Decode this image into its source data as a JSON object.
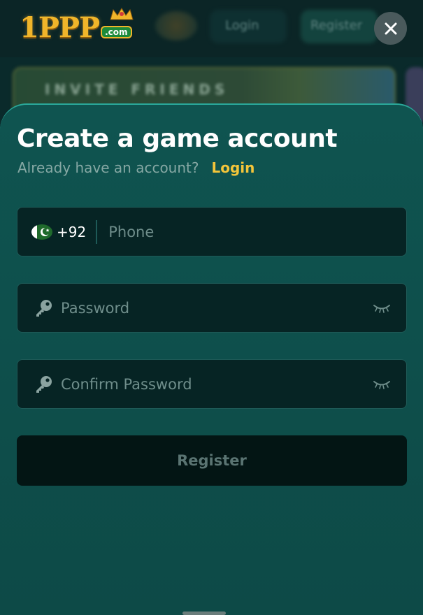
{
  "background": {
    "logo_text": "1PPP",
    "logo_suffix": ".com",
    "nav_login": "Login",
    "nav_register": "Register",
    "banner_text": "INVITE FRIENDS"
  },
  "modal": {
    "title": "Create a game account",
    "subtitle": "Already have an account?",
    "login_link": "Login",
    "phone": {
      "country_code": "+92",
      "placeholder": "Phone",
      "flag": "pakistan-flag-icon"
    },
    "password": {
      "placeholder": "Password",
      "icon": "key-icon",
      "toggle_icon": "eye-closed-icon"
    },
    "confirm_password": {
      "placeholder": "Confirm Password",
      "icon": "key-icon",
      "toggle_icon": "eye-closed-icon"
    },
    "register_label": "Register",
    "close_icon": "close-icon"
  },
  "colors": {
    "sheet_bg": "#0f5450",
    "field_bg": "#062424",
    "accent_link": "#f4c53a",
    "button_bg": "#031514",
    "button_text": "#5a7472"
  }
}
